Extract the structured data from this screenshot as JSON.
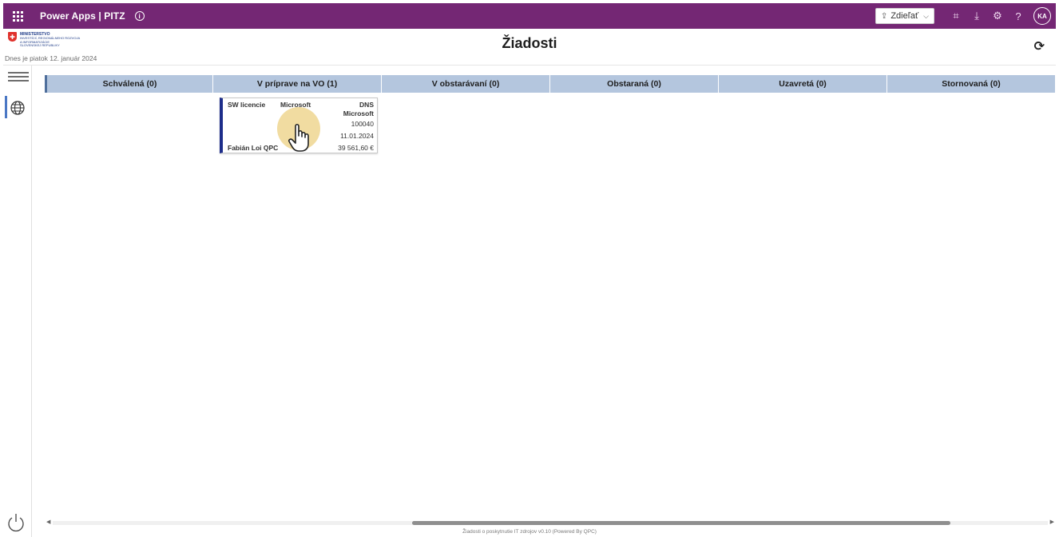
{
  "topbar": {
    "app_title": "Power Apps | PITZ",
    "share_label": "Zdieľať",
    "avatar_initials": "KA",
    "bg_color": "#742774"
  },
  "header": {
    "logo_lines": [
      "Ministerstvo",
      "investícií, regionálneho rozvoja",
      "a informatizácie",
      "Slovenskej republiky"
    ],
    "date_text": "Dnes je piatok 12. január 2024",
    "title": "Žiadosti"
  },
  "columns": [
    {
      "label": "Schválená (0)"
    },
    {
      "label": "V príprave na VO (1)"
    },
    {
      "label": "V obstarávaní (0)"
    },
    {
      "label": "Obstaraná (0)"
    },
    {
      "label": "Uzavretá (0)"
    },
    {
      "label": "Stornovaná (0)"
    }
  ],
  "card": {
    "type": "SW licencie",
    "vendor": "Microsoft",
    "dns": "DNS",
    "dns_vendor": "Microsoft",
    "id": "100040",
    "date": "11.01.2024",
    "person": "Fabián Loi QPC",
    "amount": "39 561,60 €"
  },
  "footer": {
    "text": "Žiadosti o poskytnutie IT zdrojov v0.10 (Powered By QPC)"
  },
  "icons": {
    "waffle": "waffle-icon",
    "info": "info-icon",
    "share": "share-icon",
    "refresh": "refresh-icon",
    "menu": "hamburger-icon",
    "globe": "globe-icon",
    "power": "power-icon"
  }
}
